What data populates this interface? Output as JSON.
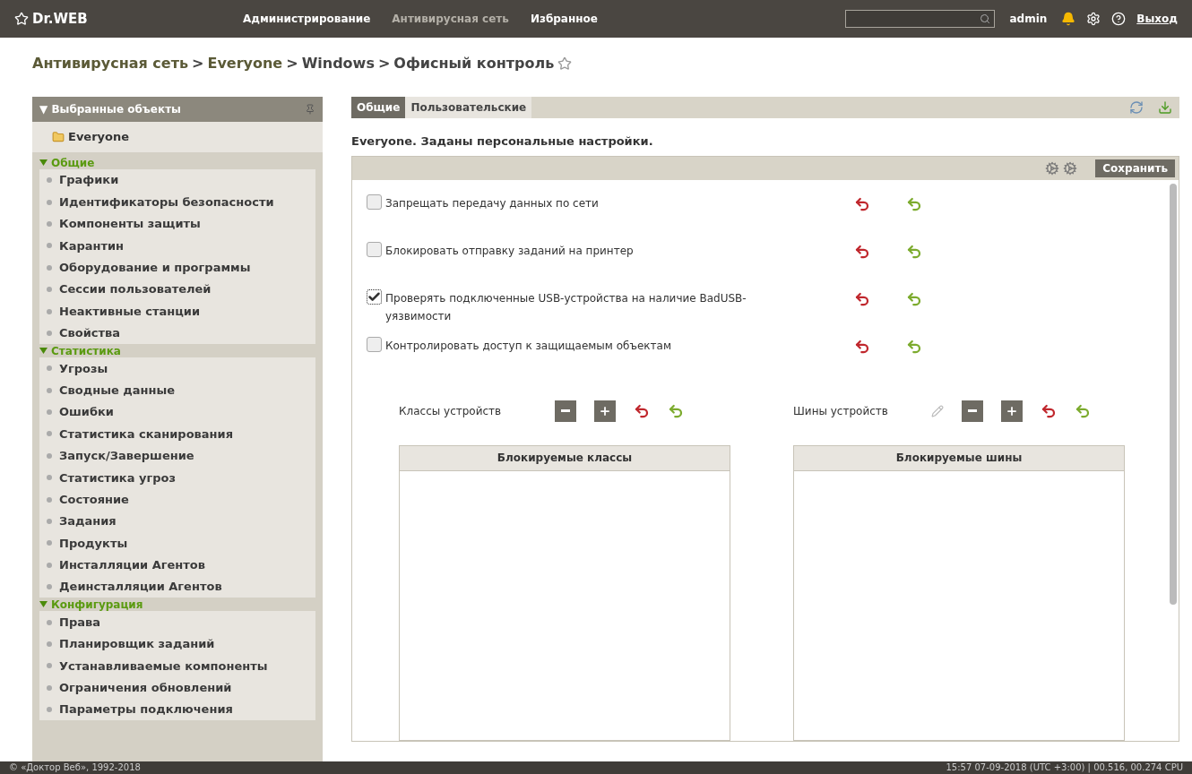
{
  "header": {
    "logo": "Dr.WEB",
    "nav": [
      {
        "label": "Администрирование",
        "selected": false
      },
      {
        "label": "Антивирусная сеть",
        "selected": true
      },
      {
        "label": "Избранное",
        "selected": false
      }
    ],
    "user": "admin",
    "logout": "Выход"
  },
  "breadcrumb": {
    "parts": [
      "Антивирусная сеть",
      ">",
      "Everyone",
      ">",
      "Windows",
      ">",
      "Офисный контроль"
    ]
  },
  "sidebar": {
    "title": "▼ Выбранные объекты",
    "selected_object": "Everyone",
    "groups": [
      {
        "title": "Общие",
        "expanded": true,
        "items": [
          "Графики",
          "Идентификаторы безопасности",
          "Компоненты защиты",
          "Карантин",
          "Оборудование и программы",
          "Сессии пользователей",
          "Неактивные станции",
          "Свойства"
        ]
      },
      {
        "title": "Статистика",
        "expanded": true,
        "items": [
          "Угрозы",
          "Сводные данные",
          "Ошибки",
          "Статистика сканирования",
          "Запуск/Завершение",
          "Статистика угроз",
          "Состояние",
          "Задания",
          "Продукты",
          "Инсталляции Агентов",
          "Деинсталляции Агентов"
        ]
      },
      {
        "title": "Конфигурация",
        "expanded": true,
        "items": [
          "Права",
          "Планировщик заданий",
          "Устанавливаемые компоненты",
          "Ограничения обновлений",
          "Параметры подключения"
        ]
      }
    ]
  },
  "tabs": [
    {
      "label": "Общие",
      "selected": true
    },
    {
      "label": "Пользовательские",
      "selected": false
    }
  ],
  "notice": "Everyone. Заданы персональные настройки.",
  "save_button": "Сохранить",
  "options": [
    {
      "label": "Запрещать передачу данных по сети",
      "checked": false
    },
    {
      "label": "Блокировать отправку заданий на принтер",
      "checked": false
    },
    {
      "label": "Проверять подключенные USB-устройства на наличие BadUSB-уязвимости",
      "checked": true
    },
    {
      "label": "Контролировать доступ к защищаемым объектам",
      "checked": false
    }
  ],
  "device_lists": [
    {
      "label": "Классы устройств",
      "editable": false,
      "table_header": "Блокируемые классы"
    },
    {
      "label": "Шины устройств",
      "editable": true,
      "table_header": "Блокируемые шины"
    }
  ],
  "footer": {
    "copyright": "© «Доктор Веб», 1992-2018",
    "status": "15:57 07-09-2018 (UTC +3:00) | 00.516, 00.274 CPU"
  }
}
